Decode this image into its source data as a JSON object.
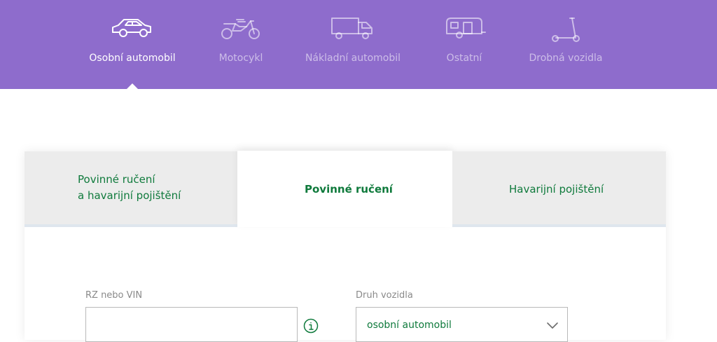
{
  "vehicle_tabs": [
    {
      "label": "Osobní automobil",
      "icon": "car-icon",
      "active": true
    },
    {
      "label": "Motocykl",
      "icon": "motorcycle-icon",
      "active": false
    },
    {
      "label": "Nákladní automobil",
      "icon": "truck-icon",
      "active": false
    },
    {
      "label": "Ostatní",
      "icon": "caravan-icon",
      "active": false
    },
    {
      "label": "Drobná vozidla",
      "icon": "scooter-icon",
      "active": false
    }
  ],
  "insurance_tabs": [
    {
      "line1": "Povinné ručení",
      "line2": "a havarijní pojištění",
      "active": false
    },
    {
      "label": "Povinné ručení",
      "active": true
    },
    {
      "label": "Havarijní pojištění",
      "active": false
    }
  ],
  "form": {
    "rz_label": "RZ nebo VIN",
    "rz_value": "",
    "vehicle_type_label": "Druh vozidla",
    "vehicle_type_value": "osobní automobil"
  },
  "colors": {
    "header_bg": "#8e6ccc",
    "accent_green": "#0f7a3c",
    "tab_inactive_bg": "#ececec"
  }
}
